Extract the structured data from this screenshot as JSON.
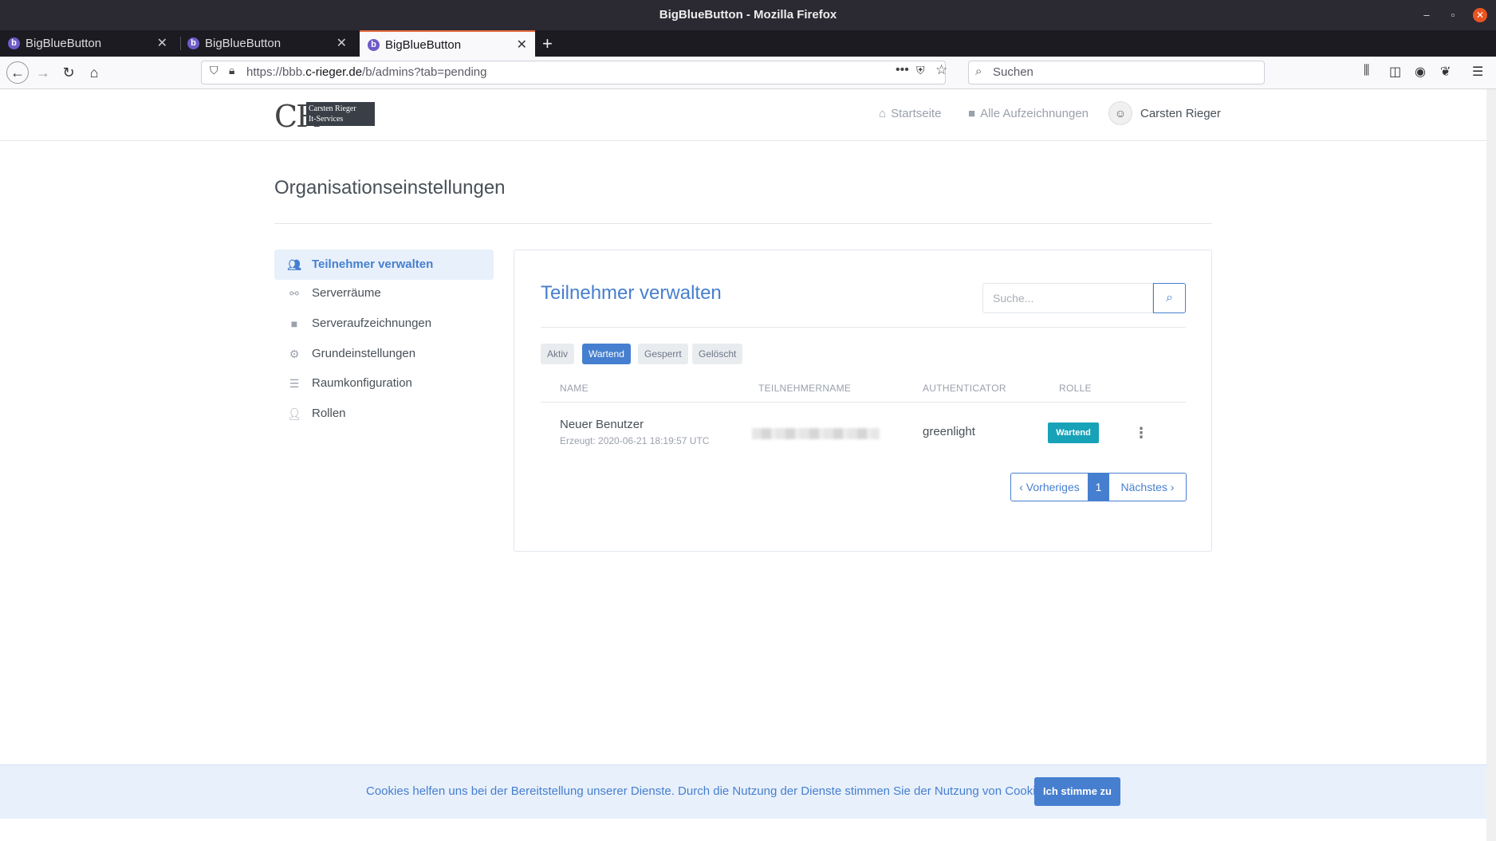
{
  "window": {
    "title": "BigBlueButton - Mozilla Firefox",
    "controls": {
      "minimize": "–",
      "maximize": "▫",
      "close": "✕"
    }
  },
  "tabs": [
    {
      "label": "BigBlueButton",
      "active": false
    },
    {
      "label": "BigBlueButton",
      "active": false
    },
    {
      "label": "BigBlueButton",
      "active": true
    }
  ],
  "navbar": {
    "url_prefix": "https://bbb.",
    "url_domain": "c-rieger.de",
    "url_path": "/b/admins?tab=pending",
    "search_placeholder": "Suchen"
  },
  "site_header": {
    "logo_letters": "CR",
    "logo_line1": "Carsten Rieger",
    "logo_line2": "It-Services",
    "nav": [
      {
        "label": "Startseite",
        "icon": "home-icon"
      },
      {
        "label": "Alle Aufzeichnungen",
        "icon": "video-icon"
      }
    ],
    "user_name": "Carsten Rieger"
  },
  "page_title": "Organisationseinstellungen",
  "sidebar": {
    "items": [
      {
        "label": "Teilnehmer verwalten",
        "icon": "users-icon",
        "active": true
      },
      {
        "label": "Serverräume",
        "icon": "binoculars-icon",
        "active": false
      },
      {
        "label": "Serveraufzeichnungen",
        "icon": "video-icon",
        "active": false
      },
      {
        "label": "Grundeinstellungen",
        "icon": "gears-icon",
        "active": false
      },
      {
        "label": "Raumkonfiguration",
        "icon": "sliders-icon",
        "active": false
      },
      {
        "label": "Rollen",
        "icon": "user-tag-icon",
        "active": false
      }
    ]
  },
  "card": {
    "title": "Teilnehmer verwalten",
    "search_placeholder": "Suche...",
    "filters": [
      "Aktiv",
      "Wartend",
      "Gesperrt",
      "Gelöscht"
    ],
    "active_filter": "Wartend",
    "columns": [
      "NAME",
      "TEILNEHMERNAME",
      "AUTHENTICATOR",
      "ROLLE"
    ],
    "rows": [
      {
        "name": "Neuer Benutzer",
        "created": "Erzeugt: 2020-06-21 18:19:57 UTC",
        "username": "",
        "authenticator": "greenlight",
        "role": "Wartend"
      }
    ],
    "pagination": {
      "prev": "‹ Vorheriges",
      "current": "1",
      "next": "Nächstes ›"
    }
  },
  "cookie_bar": {
    "text": "Cookies helfen uns bei der Bereitstellung unserer Dienste. Durch die Nutzung der Dienste stimmen Sie der Nutzung von Cookies zu.",
    "button": "Ich stimme zu"
  },
  "colors": {
    "accent": "#467fcf",
    "role_badge": "#17a2b8",
    "browser_dark": "#2b2a33"
  }
}
